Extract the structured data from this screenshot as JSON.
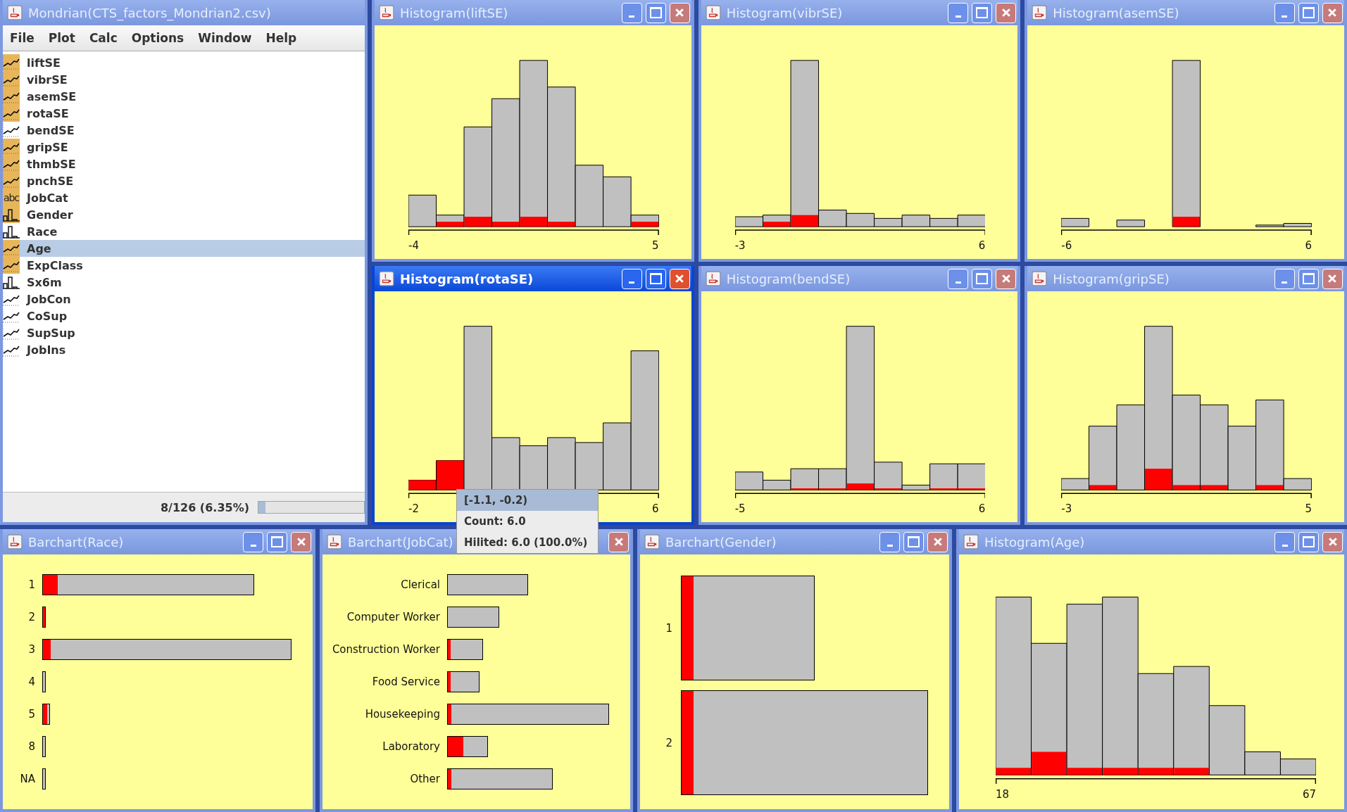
{
  "main_window": {
    "title": "Mondrian(CTS_factors_Mondrian2.csv)",
    "active": false,
    "menu": [
      "File",
      "Plot",
      "Calc",
      "Options",
      "Window",
      "Help"
    ],
    "variables": [
      {
        "name": "liftSE",
        "kind": "continuous",
        "marked": true,
        "selected": false
      },
      {
        "name": "vibrSE",
        "kind": "continuous",
        "marked": true,
        "selected": false
      },
      {
        "name": "asemSE",
        "kind": "continuous",
        "marked": true,
        "selected": false
      },
      {
        "name": "rotaSE",
        "kind": "continuous",
        "marked": true,
        "selected": false
      },
      {
        "name": "bendSE",
        "kind": "continuous",
        "marked": false,
        "selected": false
      },
      {
        "name": "gripSE",
        "kind": "continuous",
        "marked": true,
        "selected": false
      },
      {
        "name": "thmbSE",
        "kind": "continuous",
        "marked": true,
        "selected": false
      },
      {
        "name": "pnchSE",
        "kind": "continuous",
        "marked": true,
        "selected": false
      },
      {
        "name": "JobCat",
        "kind": "text",
        "icon_text": "abc",
        "marked": true,
        "selected": false
      },
      {
        "name": "Gender",
        "kind": "discrete",
        "marked": true,
        "selected": false
      },
      {
        "name": "Race",
        "kind": "discrete",
        "marked": false,
        "selected": false
      },
      {
        "name": "Age",
        "kind": "continuous",
        "marked": true,
        "selected": true
      },
      {
        "name": "ExpClass",
        "kind": "continuous",
        "marked": true,
        "selected": false
      },
      {
        "name": "Sx6m",
        "kind": "discrete",
        "marked": false,
        "selected": false
      },
      {
        "name": "JobCon",
        "kind": "continuous",
        "marked": false,
        "selected": false
      },
      {
        "name": "CoSup",
        "kind": "continuous",
        "marked": false,
        "selected": false
      },
      {
        "name": "SupSup",
        "kind": "continuous",
        "marked": false,
        "selected": false
      },
      {
        "name": "JobIns",
        "kind": "continuous",
        "marked": false,
        "selected": false
      }
    ],
    "status": {
      "text": "8/126 (6.35%)",
      "level": 0.0635
    }
  },
  "histograms": [
    {
      "title": "Histogram(liftSE)",
      "active": false,
      "axis_min": "-4",
      "axis_max": "5"
    },
    {
      "title": "Histogram(vibrSE)",
      "active": false,
      "axis_min": "-3",
      "axis_max": "6"
    },
    {
      "title": "Histogram(asemSE)",
      "active": false,
      "axis_min": "-6",
      "axis_max": "6"
    },
    {
      "title": "Histogram(rotaSE)",
      "active": true,
      "axis_min": "-2",
      "axis_max": "6"
    },
    {
      "title": "Histogram(bendSE)",
      "active": false,
      "axis_min": "-5",
      "axis_max": "6"
    },
    {
      "title": "Histogram(gripSE)",
      "active": false,
      "axis_min": "-3",
      "axis_max": "5"
    }
  ],
  "bottom_windows": [
    {
      "kind": "barchart",
      "title": "Barchart(Race)",
      "active": false,
      "categories": [
        "1",
        "2",
        "3",
        "4",
        "5",
        "8",
        "NA"
      ]
    },
    {
      "kind": "barchart_wide",
      "title": "Barchart(JobCat)",
      "active": false,
      "categories": [
        "Clerical",
        "Computer Worker",
        "Construction Worker",
        "Food Service",
        "Housekeeping",
        "Laboratory",
        "Other"
      ]
    },
    {
      "kind": "spine",
      "title": "Barchart(Gender)",
      "active": false,
      "categories": [
        "1",
        "2"
      ]
    },
    {
      "kind": "histogram",
      "title": "Histogram(Age)",
      "active": false,
      "axis_min": "18",
      "axis_max": "67"
    }
  ],
  "tooltip": {
    "rows": [
      "[-1.1, -0.2)",
      "Count: 6.0",
      "Hilited: 6.0 (100.0%)"
    ]
  }
}
